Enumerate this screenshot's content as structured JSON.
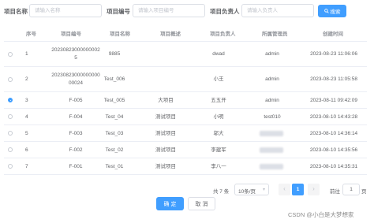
{
  "search": {
    "name_label": "项目名称",
    "name_placeholder": "请输入名称",
    "code_label": "项目编号",
    "code_placeholder": "请输入项目编号",
    "owner_label": "项目负责人",
    "owner_placeholder": "请输入负责人",
    "search_button": "搜索"
  },
  "table": {
    "headers": [
      "序号",
      "项目编号",
      "项目名称",
      "项目概述",
      "项目负责人",
      "所属管理员",
      "创建时间"
    ],
    "rows": [
      {
        "index": "1",
        "code_line1": "20230823000000002",
        "code_line2": "5",
        "name": "9885",
        "desc": "",
        "owner": "dwad",
        "admin": "admin",
        "time": "2023-08-23 11:06:06",
        "selected": false
      },
      {
        "index": "2",
        "code_line1": "20230823000000000",
        "code_line2": "00024",
        "name": "Test_006",
        "desc": "",
        "owner": "小王",
        "admin": "admin",
        "time": "2023-08-23 11:05:58",
        "selected": false
      },
      {
        "index": "3",
        "code_line1": "F-005",
        "code_line2": "",
        "name": "Test_005",
        "desc": "大项目",
        "owner": "五五开",
        "admin": "admin",
        "time": "2023-08-11 09:42:09",
        "selected": true
      },
      {
        "index": "4",
        "code_line1": "F-004",
        "code_line2": "",
        "name": "Test_04",
        "desc": "测试项目",
        "owner": "小明",
        "admin": "test010",
        "time": "2023-08-10 14:43:28",
        "selected": false
      },
      {
        "index": "5",
        "code_line1": "F-003",
        "code_line2": "",
        "name": "Test_03",
        "desc": "测试项目",
        "owner": "邬大",
        "admin": "",
        "time": "2023-08-10 14:36:14",
        "selected": false
      },
      {
        "index": "6",
        "code_line1": "F-002",
        "code_line2": "",
        "name": "Test_02",
        "desc": "测试项目",
        "owner": "李建军",
        "admin": "",
        "time": "2023-08-10 14:35:56",
        "selected": false
      },
      {
        "index": "7",
        "code_line1": "F-001",
        "code_line2": "",
        "name": "Test_01",
        "desc": "测试项目",
        "owner": "李八一",
        "admin": "",
        "time": "2023-08-10 14:35:31",
        "selected": false
      }
    ]
  },
  "pager": {
    "total": "共 7 条",
    "page_size": "10条/页",
    "prev": "‹",
    "current": "1",
    "next": "›",
    "goto": "前往",
    "jump_value": "1",
    "page_unit": "页"
  },
  "footer": {
    "ok": "确 定",
    "cancel": "取 消"
  },
  "watermark": "CSDN @小白是大梦想家",
  "colors": {
    "primary": "#409eff",
    "border": "#ebeef5"
  }
}
